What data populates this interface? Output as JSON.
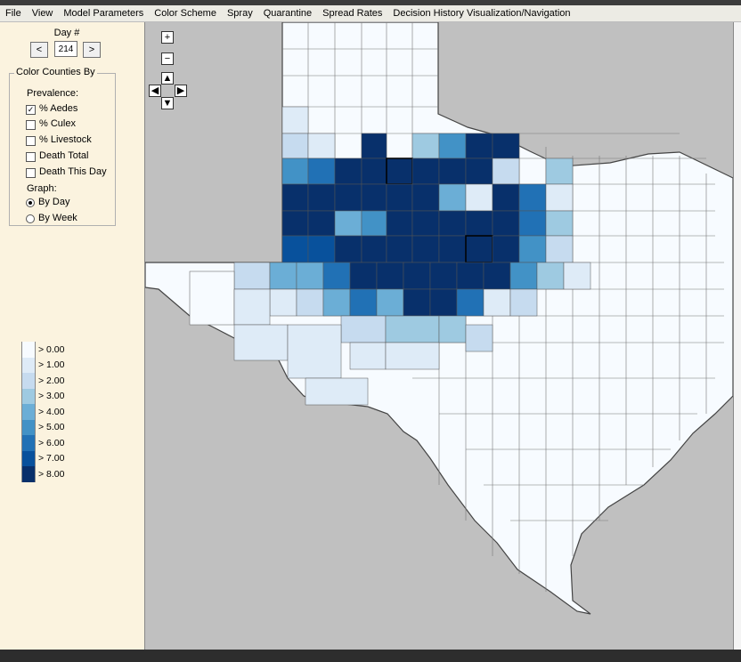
{
  "menu": [
    "File",
    "View",
    "Model Parameters",
    "Color Scheme",
    "Spray",
    "Quarantine",
    "Spread Rates",
    "Decision History Visualization/Navigation"
  ],
  "day": {
    "label": "Day #",
    "prev": "<",
    "next": ">",
    "value": "214"
  },
  "color_by": {
    "title": "Color Counties By",
    "prevalence_label": "Prevalence:",
    "options": [
      {
        "label": "% Aedes",
        "checked": true
      },
      {
        "label": "% Culex",
        "checked": false
      },
      {
        "label": "% Livestock",
        "checked": false
      },
      {
        "label": "Death Total",
        "checked": false
      },
      {
        "label": "Death This Day",
        "checked": false
      }
    ],
    "graph_label": "Graph:",
    "graph_options": [
      {
        "label": "By Day",
        "selected": true
      },
      {
        "label": "By Week",
        "selected": false
      }
    ]
  },
  "legend": [
    {
      "label": "> 0.00",
      "color": "#f7fbff"
    },
    {
      "label": "> 1.00",
      "color": "#deebf7"
    },
    {
      "label": "> 2.00",
      "color": "#c6dbef"
    },
    {
      "label": "> 3.00",
      "color": "#9ecae1"
    },
    {
      "label": "> 4.00",
      "color": "#6baed6"
    },
    {
      "label": "> 5.00",
      "color": "#4292c6"
    },
    {
      "label": "> 6.00",
      "color": "#2171b5"
    },
    {
      "label": "> 7.00",
      "color": "#08519c"
    },
    {
      "label": "> 8.00",
      "color": "#08306b"
    }
  ],
  "map_nav": {
    "zoom_in": "+",
    "zoom_out": "−",
    "up": "▲",
    "down": "▼",
    "left": "◀",
    "right": "▶"
  }
}
